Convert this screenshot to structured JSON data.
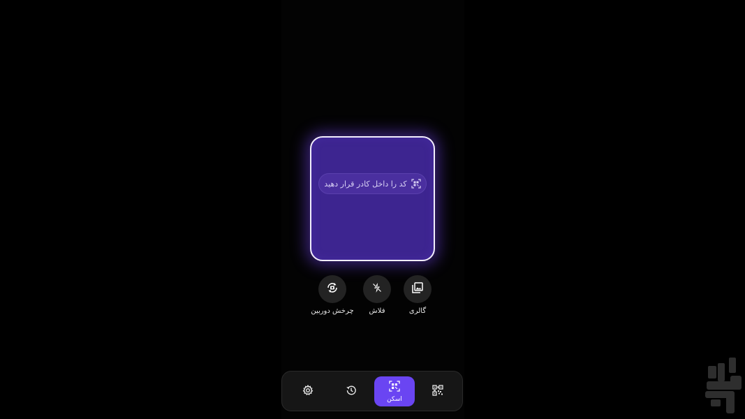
{
  "scanner": {
    "hint_text": "کد را داخل کادر قرار دهید",
    "hint_icon": "qr-scan-icon"
  },
  "actions": {
    "gallery_label": "گالری",
    "gallery_icon": "gallery-icon",
    "flash_label": "فلاش",
    "flash_icon": "flash-off-icon",
    "rotate_label": "چرخش دوربین",
    "rotate_icon": "camera-rotate-icon"
  },
  "nav": {
    "scan_label": "اسکن",
    "items": [
      "qr-code-icon",
      "scan-icon",
      "history-icon",
      "settings-icon"
    ]
  },
  "colors": {
    "background": "#000000",
    "scan_frame_fill": "#3d2590",
    "accent": "#6a45f2",
    "button_bg": "#232323"
  }
}
